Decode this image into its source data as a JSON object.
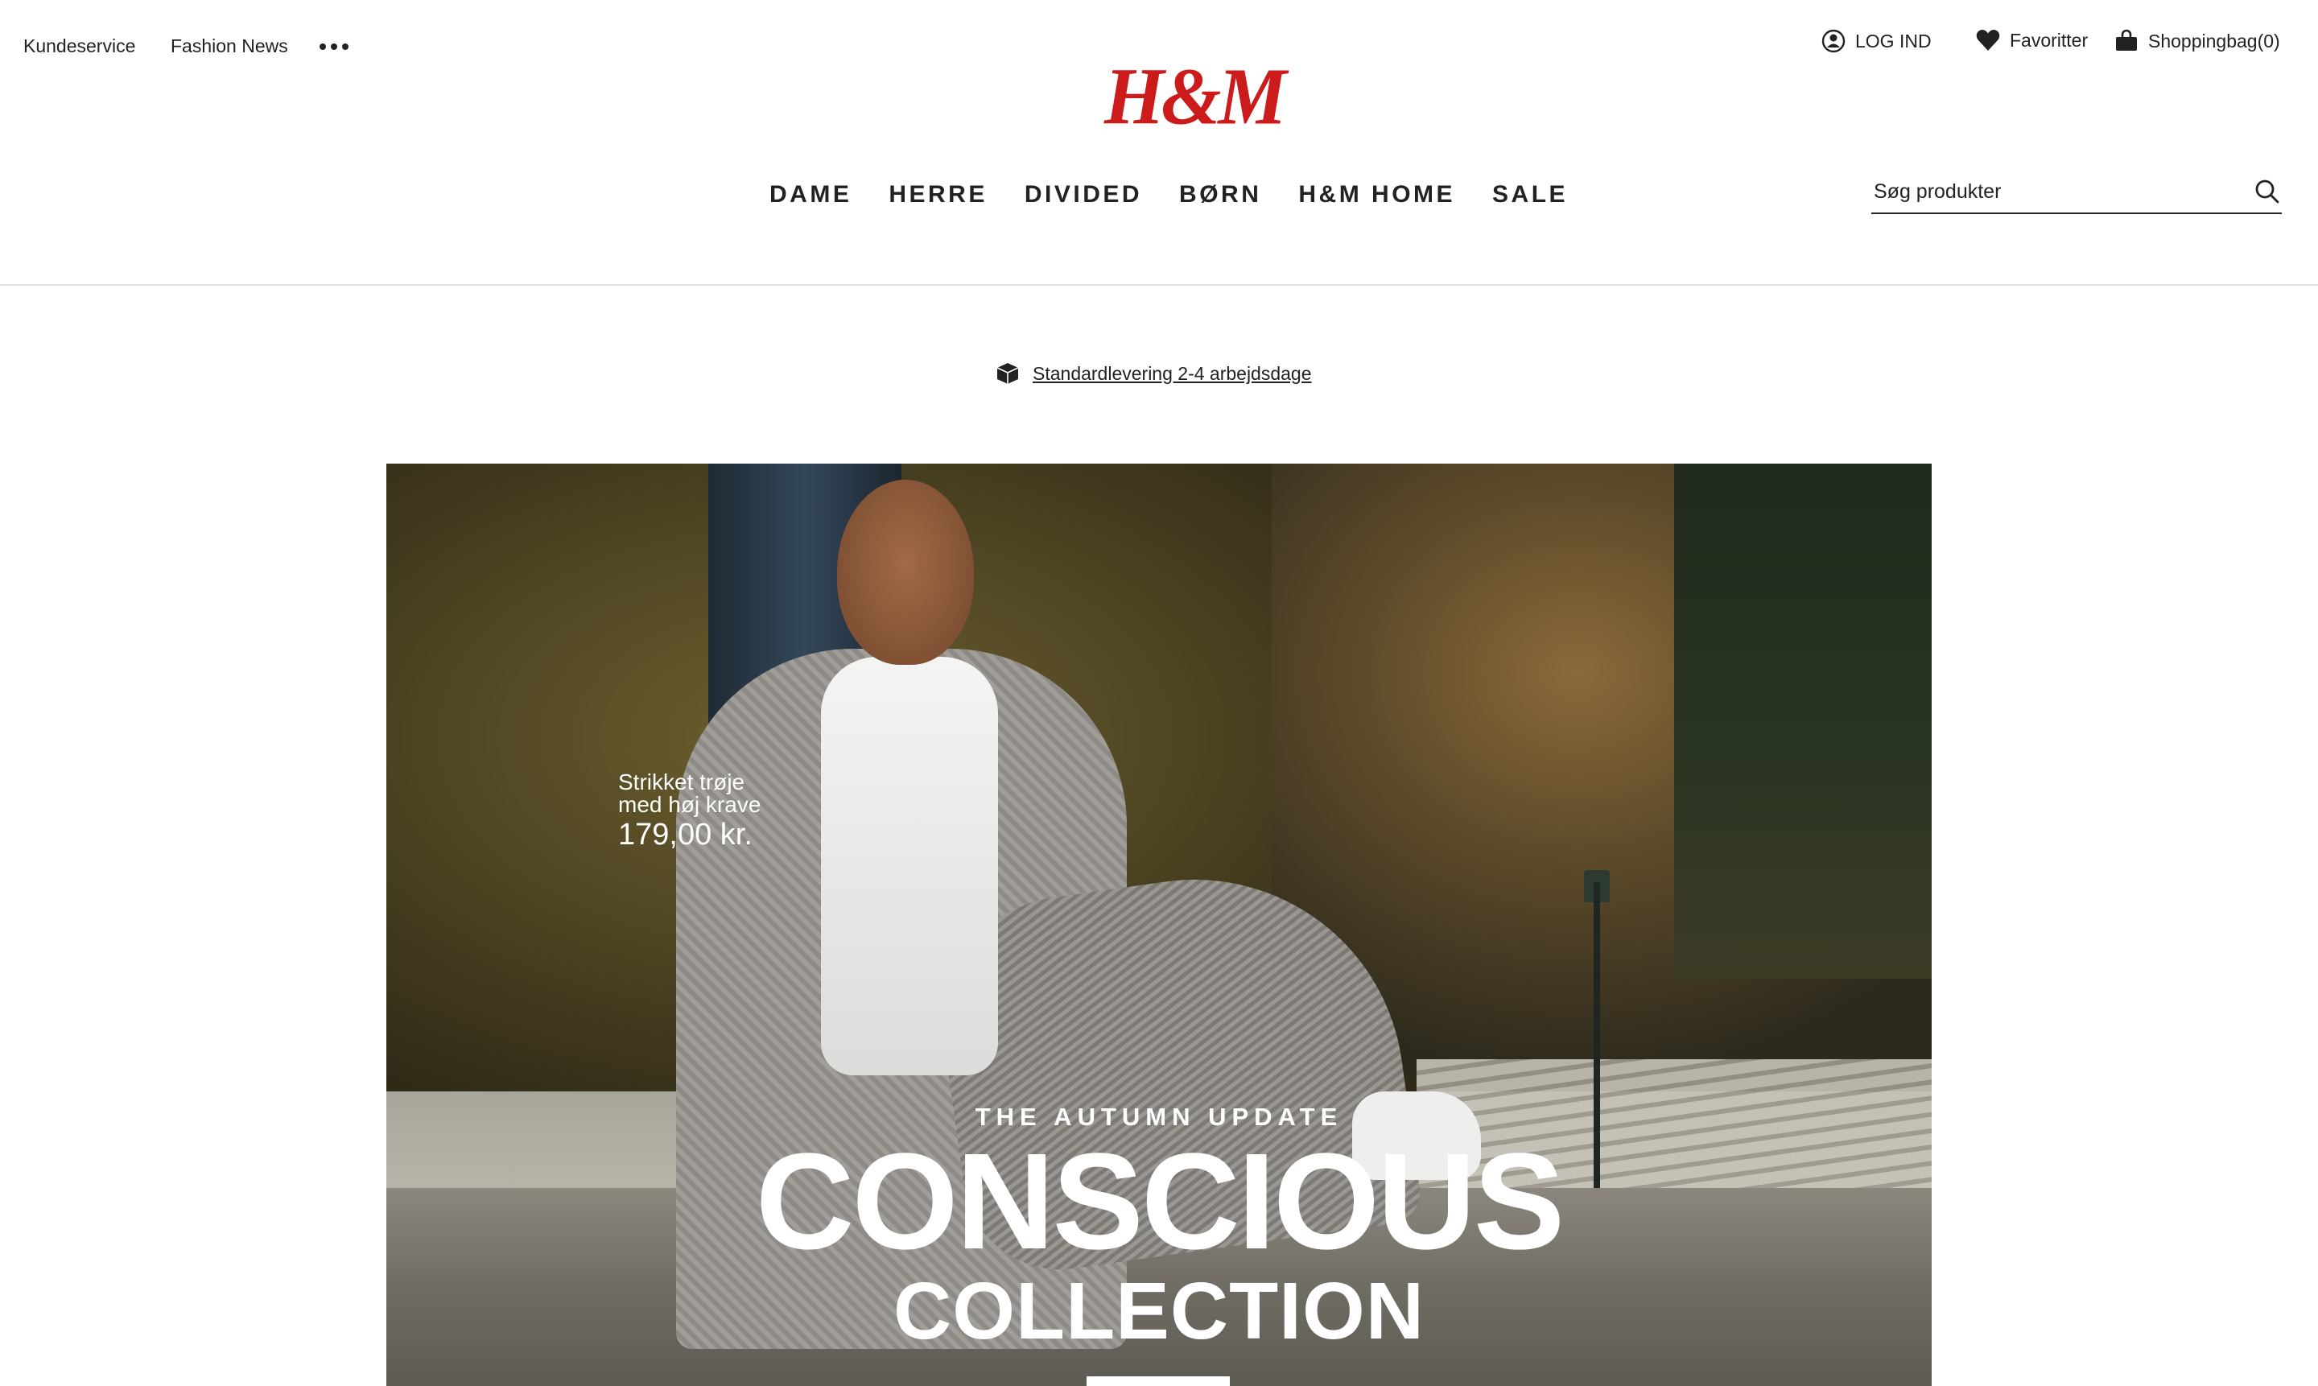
{
  "utility_nav": {
    "customer_service": "Kundeservice",
    "fashion_news": "Fashion News"
  },
  "account": {
    "login": "LOG IND",
    "favorites": "Favoritter",
    "bag": "Shoppingbag(0)"
  },
  "brand": {
    "logo": "H&M",
    "color": "#cc1b1b"
  },
  "main_nav": [
    "DAME",
    "HERRE",
    "DIVIDED",
    "BØRN",
    "H&M HOME",
    "SALE"
  ],
  "search": {
    "placeholder": "Søg produkter",
    "icon": "search-icon"
  },
  "delivery": {
    "icon": "box-icon",
    "text": "Standardlevering 2-4 arbejdsdage"
  },
  "hero": {
    "product_name_line1": "Strikket trøje",
    "product_name_line2": "med høj krave",
    "product_price": "179,00 kr.",
    "kicker": "THE AUTUMN UPDATE",
    "title": "CONSCIOUS",
    "subtitle": "COLLECTION"
  }
}
